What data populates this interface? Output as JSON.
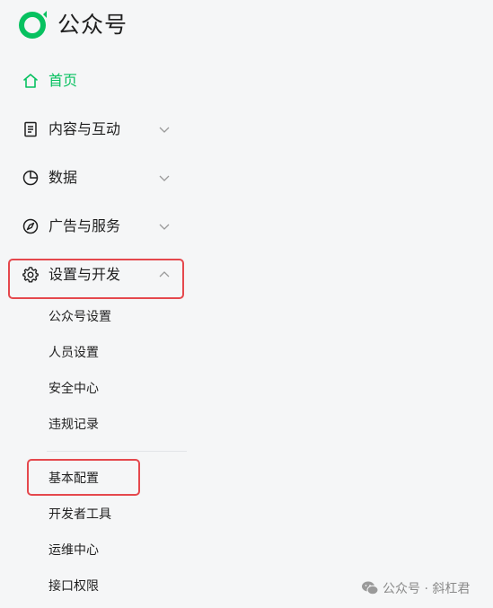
{
  "app": {
    "title": "公众号"
  },
  "colors": {
    "accent": "#07c160",
    "highlight": "#e5484d",
    "text": "#1f1f1f",
    "muted": "#8a8a8a"
  },
  "nav": {
    "home": {
      "label": "首页",
      "icon": "home-icon"
    },
    "content": {
      "label": "内容与互动",
      "icon": "document-icon",
      "expanded": false
    },
    "data": {
      "label": "数据",
      "icon": "pie-chart-icon",
      "expanded": false
    },
    "ads": {
      "label": "广告与服务",
      "icon": "compass-icon",
      "expanded": false
    },
    "settings": {
      "label": "设置与开发",
      "icon": "gear-icon",
      "expanded": true,
      "items": [
        {
          "label": "公众号设置"
        },
        {
          "label": "人员设置"
        },
        {
          "label": "安全中心"
        },
        {
          "label": "违规记录"
        },
        {
          "label": "基本配置"
        },
        {
          "label": "开发者工具"
        },
        {
          "label": "运维中心"
        },
        {
          "label": "接口权限"
        }
      ]
    }
  },
  "watermark": {
    "text": "公众号 · 斜杠君",
    "icon": "wechat-icon"
  }
}
